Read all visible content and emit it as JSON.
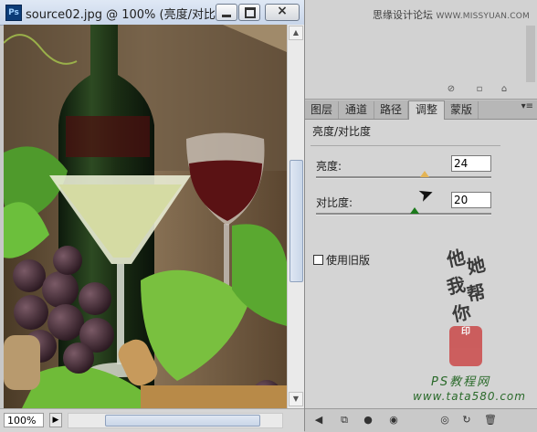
{
  "document": {
    "app_icon": "Ps",
    "title": "source02.jpg @ 100% (亮度/对比...",
    "zoom": "100%",
    "window_buttons": {
      "minimize": "minimize-icon",
      "maximize": "maximize-icon",
      "close": "×"
    }
  },
  "watermark_top": {
    "text": "思缘设计论坛",
    "site": "WWW.MISSYUAN.COM"
  },
  "panel": {
    "tabs": [
      "图层",
      "通道",
      "路径",
      "调整",
      "蒙版"
    ],
    "active_tab": "调整",
    "menu_icon": "▾≡",
    "adjustment_title": "亮度/对比度",
    "brightness": {
      "label": "亮度:",
      "value": "24",
      "fraction": 0.62
    },
    "contrast": {
      "label": "对比度:",
      "value": "20",
      "fraction": 0.56
    },
    "legacy_label": "使用旧版"
  },
  "signature": {
    "chars": [
      "他",
      "她",
      "我",
      "帮",
      "你"
    ],
    "seal": "印"
  },
  "watermark_bottom": {
    "ps": "PS教程网",
    "url": "www.tata580.com"
  },
  "colors": {
    "accent_tab": "#d4d4d4",
    "slider_thumb": "#1c7a1c",
    "watermark_green": "#2a6a2a"
  }
}
